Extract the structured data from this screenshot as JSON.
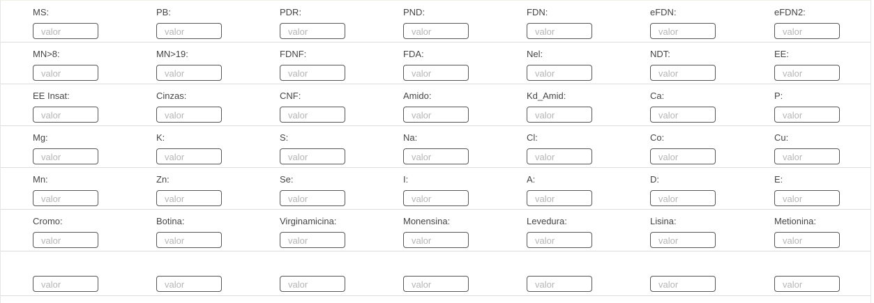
{
  "form": {
    "placeholder": "valor",
    "rows": [
      [
        "MS:",
        "PB:",
        "PDR:",
        "PND:",
        "FDN:",
        "eFDN:",
        "eFDN2:"
      ],
      [
        "MN>8:",
        "MN>19:",
        "FDNF:",
        "FDA:",
        "Nel:",
        "NDT:",
        "EE:"
      ],
      [
        "EE Insat:",
        "Cinzas:",
        "CNF:",
        "Amido:",
        "Kd_Amid:",
        "Ca:",
        "P:"
      ],
      [
        "Mg:",
        "K:",
        "S:",
        "Na:",
        "Cl:",
        "Co:",
        "Cu:"
      ],
      [
        "Mn:",
        "Zn:",
        "Se:",
        "I:",
        "A:",
        "D:",
        "E:"
      ],
      [
        "Cromo:",
        "Botina:",
        "Virginamicina:",
        "Monensina:",
        "Levedura:",
        "Lisina:",
        "Metionina:"
      ],
      [
        "",
        "",
        "",
        "",
        "",
        "",
        ""
      ]
    ]
  }
}
